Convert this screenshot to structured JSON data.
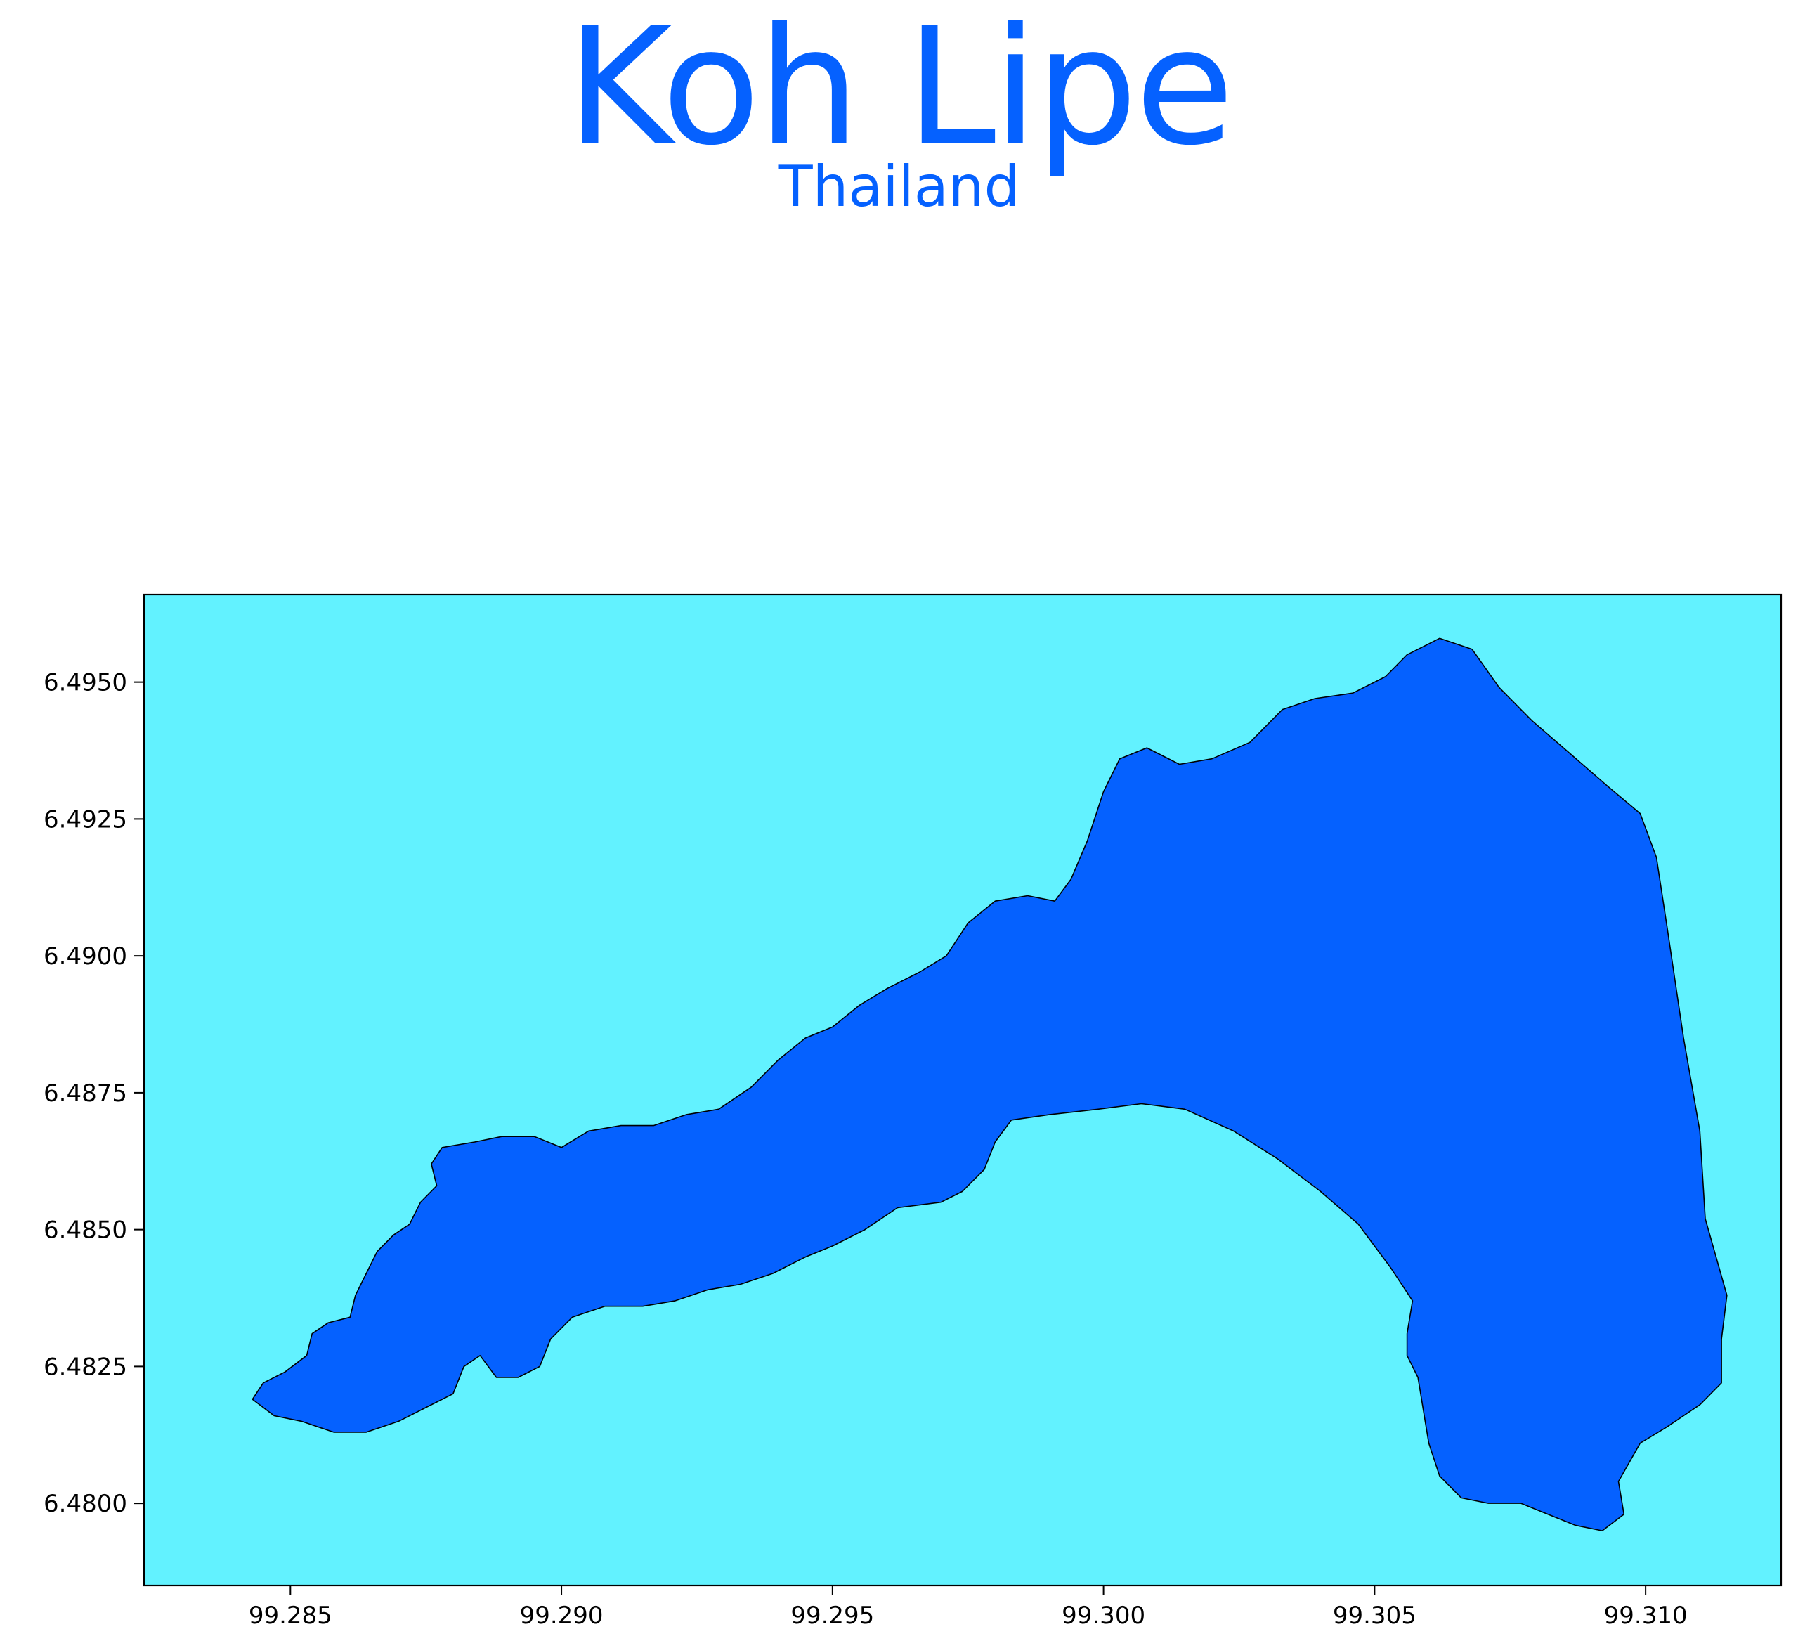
{
  "title": "Koh Lipe",
  "subtitle": "Thailand",
  "colors": {
    "title": "#0561ff",
    "water": "#62f2ff",
    "land": "#0561ff",
    "coastline": "#000000",
    "frame": "#000000"
  },
  "map": {
    "type": "choropleth-outline",
    "feature": "island",
    "lon_range": [
      99.2823,
      99.3125
    ],
    "lat_range": [
      6.4785,
      6.4966
    ],
    "x_ticks": [
      99.285,
      99.29,
      99.295,
      99.3,
      99.305,
      99.31
    ],
    "x_tick_labels": [
      "99.285",
      "99.290",
      "99.295",
      "99.300",
      "99.305",
      "99.310"
    ],
    "y_ticks": [
      6.48,
      6.4825,
      6.485,
      6.4875,
      6.49,
      6.4925,
      6.495
    ],
    "y_tick_labels": [
      "6.4800",
      "6.4825",
      "6.4850",
      "6.4875",
      "6.4900",
      "6.4925",
      "6.4950"
    ],
    "grid": false,
    "coastline": [
      [
        99.2845,
        6.4822
      ],
      [
        99.2849,
        6.4824
      ],
      [
        99.2853,
        6.4827
      ],
      [
        99.2854,
        6.4831
      ],
      [
        99.2857,
        6.4833
      ],
      [
        99.2861,
        6.4834
      ],
      [
        99.2862,
        6.4838
      ],
      [
        99.2864,
        6.4842
      ],
      [
        99.2866,
        6.4846
      ],
      [
        99.2869,
        6.4849
      ],
      [
        99.2872,
        6.4851
      ],
      [
        99.2874,
        6.4855
      ],
      [
        99.2877,
        6.4858
      ],
      [
        99.2876,
        6.4862
      ],
      [
        99.2878,
        6.4865
      ],
      [
        99.2884,
        6.4866
      ],
      [
        99.2889,
        6.4867
      ],
      [
        99.2895,
        6.4867
      ],
      [
        99.29,
        6.4865
      ],
      [
        99.2905,
        6.4868
      ],
      [
        99.2911,
        6.4869
      ],
      [
        99.2917,
        6.4869
      ],
      [
        99.2923,
        6.4871
      ],
      [
        99.2929,
        6.4872
      ],
      [
        99.2935,
        6.4876
      ],
      [
        99.294,
        6.4881
      ],
      [
        99.2945,
        6.4885
      ],
      [
        99.295,
        6.4887
      ],
      [
        99.2955,
        6.4891
      ],
      [
        99.296,
        6.4894
      ],
      [
        99.2966,
        6.4897
      ],
      [
        99.2971,
        6.49
      ],
      [
        99.2975,
        6.4906
      ],
      [
        99.298,
        6.491
      ],
      [
        99.2986,
        6.4911
      ],
      [
        99.2991,
        6.491
      ],
      [
        99.2994,
        6.4914
      ],
      [
        99.2997,
        6.4921
      ],
      [
        99.3,
        6.493
      ],
      [
        99.3003,
        6.4936
      ],
      [
        99.3008,
        6.4938
      ],
      [
        99.3014,
        6.4935
      ],
      [
        99.302,
        6.4936
      ],
      [
        99.3027,
        6.4939
      ],
      [
        99.3033,
        6.4945
      ],
      [
        99.3039,
        6.4947
      ],
      [
        99.3046,
        6.4948
      ],
      [
        99.3052,
        6.4951
      ],
      [
        99.3056,
        6.4955
      ],
      [
        99.3062,
        6.4958
      ],
      [
        99.3068,
        6.4956
      ],
      [
        99.3073,
        6.4949
      ],
      [
        99.3079,
        6.4943
      ],
      [
        99.3086,
        6.4937
      ],
      [
        99.3093,
        6.4931
      ],
      [
        99.3099,
        6.4926
      ],
      [
        99.3102,
        6.4918
      ],
      [
        99.3104,
        6.4905
      ],
      [
        99.3107,
        6.4885
      ],
      [
        99.311,
        6.4868
      ],
      [
        99.3111,
        6.4852
      ],
      [
        99.3113,
        6.4845
      ],
      [
        99.3115,
        6.4838
      ],
      [
        99.3114,
        6.483
      ],
      [
        99.3114,
        6.4822
      ],
      [
        99.311,
        6.4818
      ],
      [
        99.3104,
        6.4814
      ],
      [
        99.3099,
        6.4811
      ],
      [
        99.3095,
        6.4804
      ],
      [
        99.3096,
        6.4798
      ],
      [
        99.3092,
        6.4795
      ],
      [
        99.3087,
        6.4796
      ],
      [
        99.3082,
        6.4798
      ],
      [
        99.3077,
        6.48
      ],
      [
        99.3071,
        6.48
      ],
      [
        99.3066,
        6.4801
      ],
      [
        99.3062,
        6.4805
      ],
      [
        99.306,
        6.4811
      ],
      [
        99.3059,
        6.4817
      ],
      [
        99.3058,
        6.4823
      ],
      [
        99.3056,
        6.4827
      ],
      [
        99.3056,
        6.4831
      ],
      [
        99.3057,
        6.4837
      ],
      [
        99.3053,
        6.4843
      ],
      [
        99.3047,
        6.4851
      ],
      [
        99.304,
        6.4857
      ],
      [
        99.3032,
        6.4863
      ],
      [
        99.3024,
        6.4868
      ],
      [
        99.3015,
        6.4872
      ],
      [
        99.3007,
        6.4873
      ],
      [
        99.2999,
        6.4872
      ],
      [
        99.299,
        6.4871
      ],
      [
        99.2983,
        6.487
      ],
      [
        99.298,
        6.4866
      ],
      [
        99.2978,
        6.4861
      ],
      [
        99.2974,
        6.4857
      ],
      [
        99.297,
        6.4855
      ],
      [
        99.2962,
        6.4854
      ],
      [
        99.2956,
        6.485
      ],
      [
        99.295,
        6.4847
      ],
      [
        99.2945,
        6.4845
      ],
      [
        99.2939,
        6.4842
      ],
      [
        99.2933,
        6.484
      ],
      [
        99.2927,
        6.4839
      ],
      [
        99.2921,
        6.4837
      ],
      [
        99.2915,
        6.4836
      ],
      [
        99.2908,
        6.4836
      ],
      [
        99.2902,
        6.4834
      ],
      [
        99.2898,
        6.483
      ],
      [
        99.2896,
        6.4825
      ],
      [
        99.2892,
        6.4823
      ],
      [
        99.2888,
        6.4823
      ],
      [
        99.2885,
        6.4827
      ],
      [
        99.2882,
        6.4825
      ],
      [
        99.288,
        6.482
      ],
      [
        99.2876,
        6.4818
      ],
      [
        99.287,
        6.4815
      ],
      [
        99.2864,
        6.4813
      ],
      [
        99.2858,
        6.4813
      ],
      [
        99.2852,
        6.4815
      ],
      [
        99.2847,
        6.4816
      ],
      [
        99.2843,
        6.4819
      ],
      [
        99.2845,
        6.4822
      ]
    ]
  }
}
